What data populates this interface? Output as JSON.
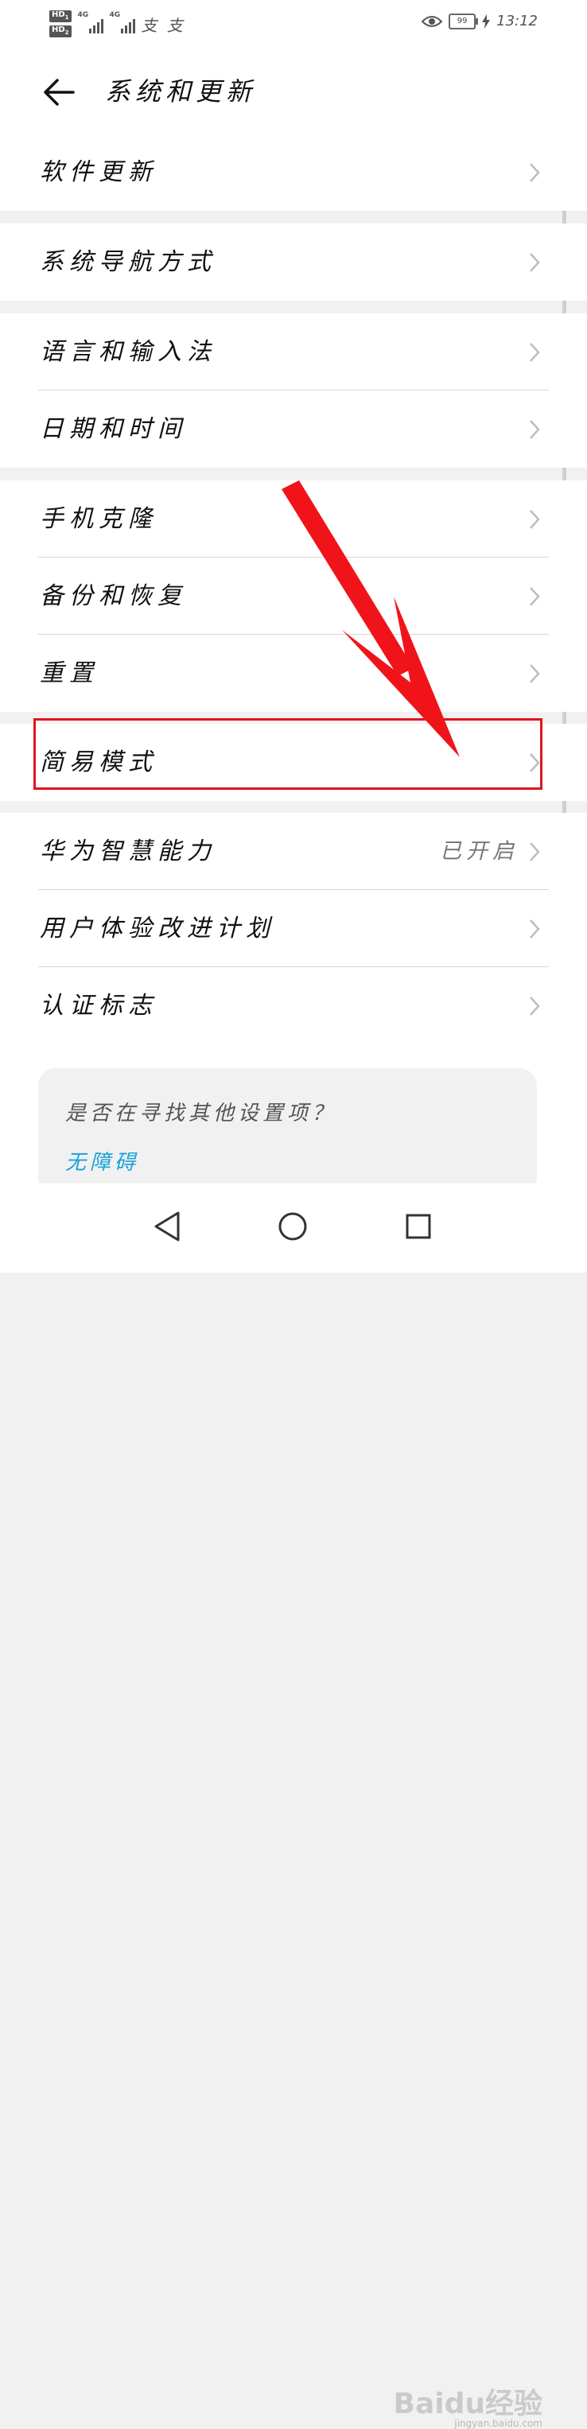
{
  "status_bar": {
    "sim1": "HD",
    "sim1_index": "1",
    "sim2": "HD",
    "sim2_index": "2",
    "network1": "4G",
    "network2": "4G",
    "app_icons": "支 支",
    "battery": "99",
    "time": "13:12"
  },
  "header": {
    "title": "系统和更新"
  },
  "groups": [
    {
      "items": [
        {
          "label": "软件更新"
        }
      ]
    },
    {
      "items": [
        {
          "label": "系统导航方式"
        }
      ]
    },
    {
      "items": [
        {
          "label": "语言和输入法"
        },
        {
          "label": "日期和时间"
        }
      ]
    },
    {
      "items": [
        {
          "label": "手机克隆"
        },
        {
          "label": "备份和恢复"
        },
        {
          "label": "重置"
        }
      ]
    },
    {
      "items": [
        {
          "label": "简易模式",
          "highlighted": true
        }
      ]
    },
    {
      "items": [
        {
          "label": "华为智慧能力",
          "value": "已开启"
        },
        {
          "label": "用户体验改进计划"
        },
        {
          "label": "认证标志"
        }
      ]
    }
  ],
  "search_card": {
    "question": "是否在寻找其他设置项？",
    "link": "无障碍"
  },
  "watermark": {
    "brand": "Baidu经验",
    "url": "jingyan.baidu.com"
  },
  "colors": {
    "highlight": "#e1141e",
    "link": "#1aa2d8",
    "separator": "#f1f1f1"
  }
}
